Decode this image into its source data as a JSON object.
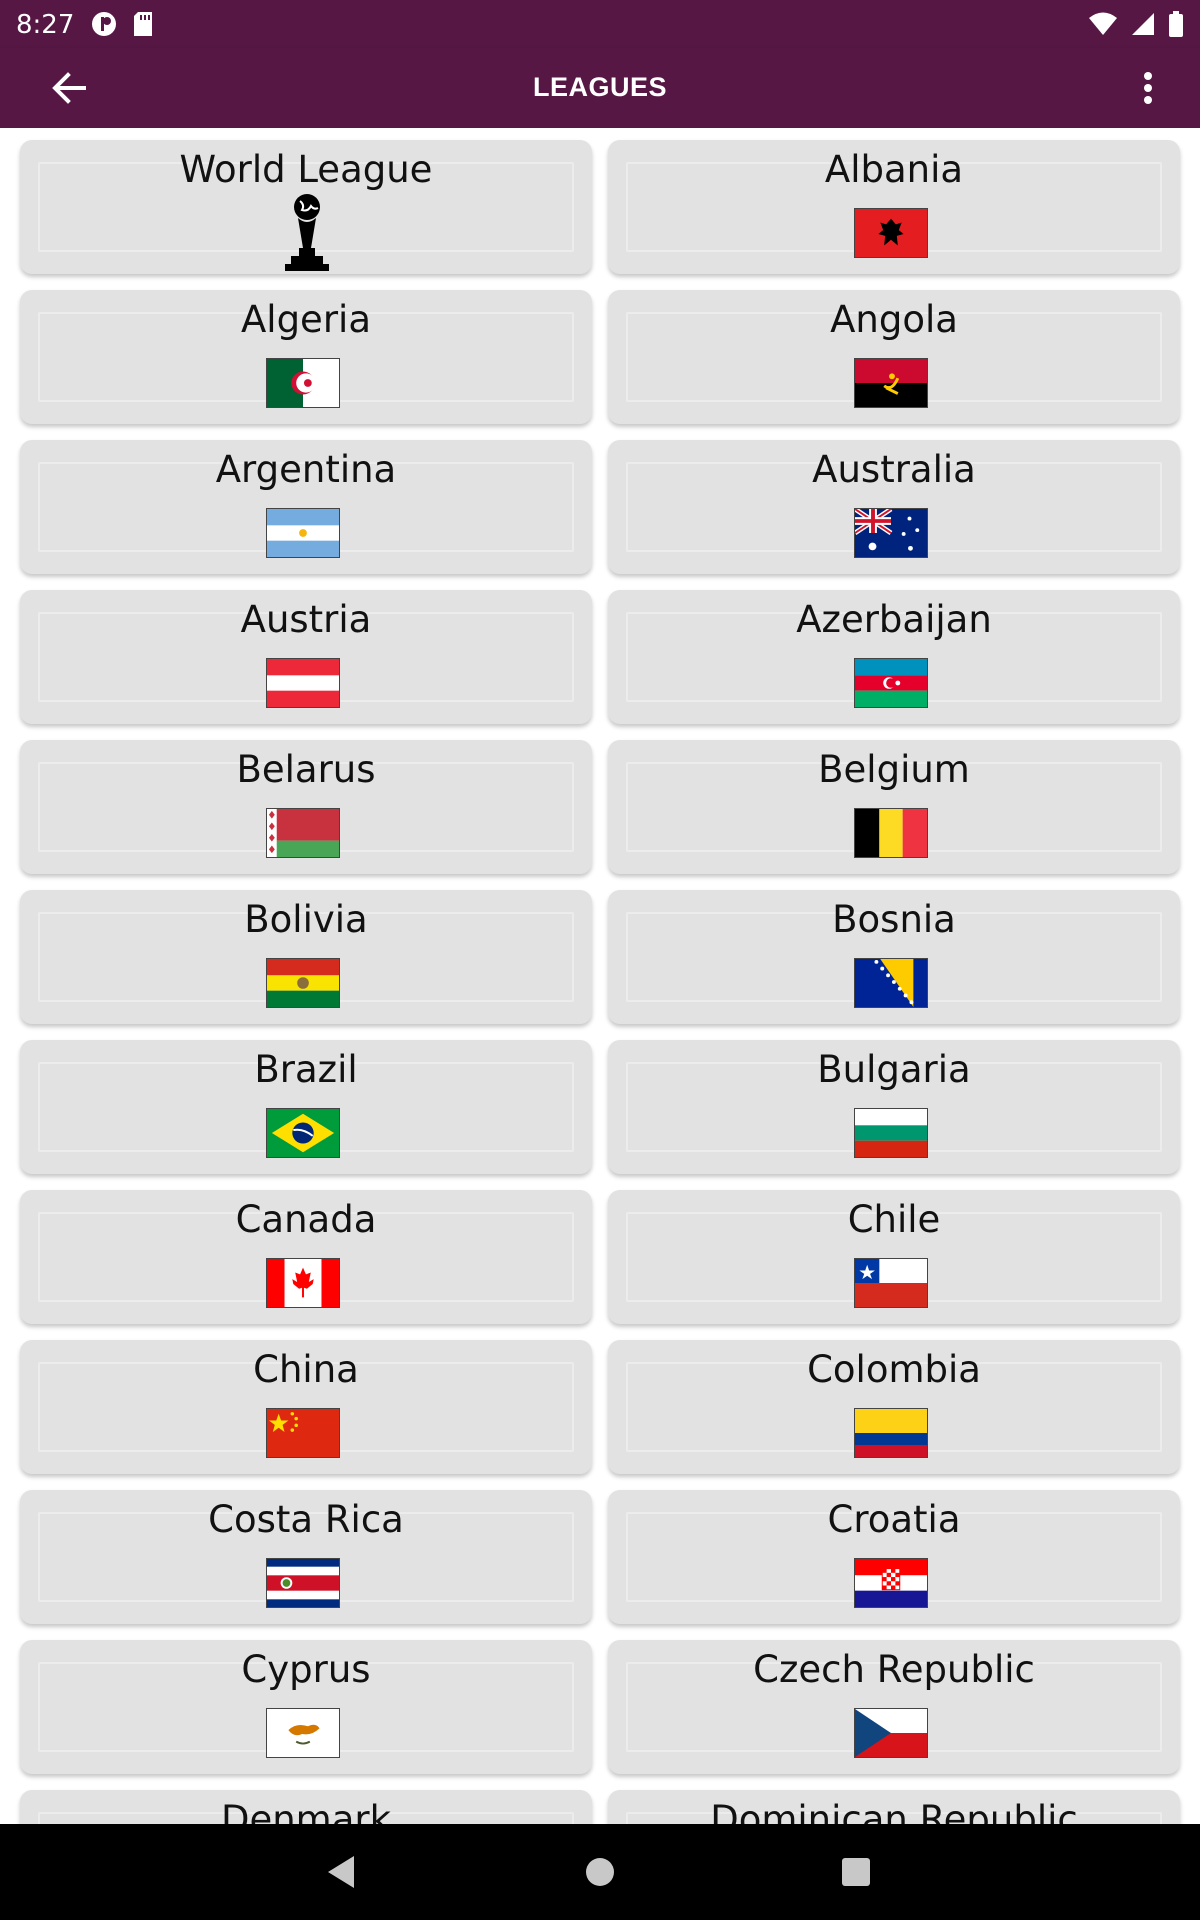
{
  "status_bar": {
    "time": "8:27"
  },
  "app_bar": {
    "title": "LEAGUES"
  },
  "leagues": [
    "World League",
    "Albania",
    "Algeria",
    "Angola",
    "Argentina",
    "Australia",
    "Austria",
    "Azerbaijan",
    "Belarus",
    "Belgium",
    "Bolivia",
    "Bosnia",
    "Brazil",
    "Bulgaria",
    "Canada",
    "Chile",
    "China",
    "Colombia",
    "Costa Rica",
    "Croatia",
    "Cyprus",
    "Czech Republic",
    "Denmark",
    "Dominican Republic"
  ],
  "colors": {
    "primary": "#561744",
    "card": "#e2e2e2",
    "navbar": "#000000"
  }
}
